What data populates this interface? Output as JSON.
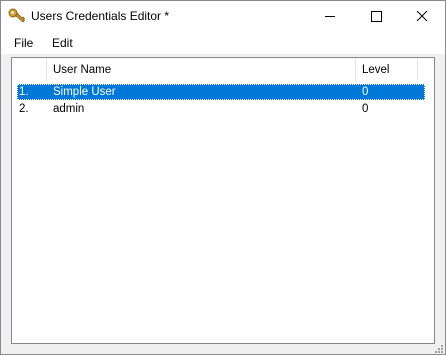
{
  "window": {
    "title": "Users Credentials Editor *",
    "icon": "key-icon",
    "controls": {
      "minimize_icon": "minimize-icon",
      "maximize_icon": "maximize-icon",
      "close_icon": "close-icon"
    }
  },
  "menu": {
    "items": [
      {
        "label": "File"
      },
      {
        "label": "Edit"
      }
    ]
  },
  "table": {
    "columns": [
      "",
      "User Name",
      "Level"
    ],
    "rows": [
      {
        "index": "1.",
        "user_name": "Simple User",
        "level": "0",
        "selected": true
      },
      {
        "index": "2.",
        "user_name": "admin",
        "level": "0",
        "selected": false
      }
    ]
  },
  "colors": {
    "selection": "#0078d7",
    "titlebar": "#ffffff",
    "window_bg": "#f0f0f0",
    "list_border": "#828790"
  }
}
